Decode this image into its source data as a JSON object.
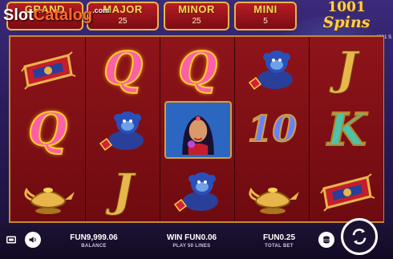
{
  "jackpots": [
    {
      "label": "GRAND",
      "value": ""
    },
    {
      "label": "MAJOR",
      "value": "25"
    },
    {
      "label": "MINOR",
      "value": "25"
    },
    {
      "label": "MINI",
      "value": "5"
    }
  ],
  "logo": {
    "number": "1001",
    "word": "Spins"
  },
  "version": "1001 S",
  "watermark": {
    "part1": "Slot",
    "part2": "Catalog",
    "suffix": ".com"
  },
  "reels": [
    [
      "magic-carpet",
      "Q",
      "lamp"
    ],
    [
      "Q",
      "monkey",
      "J"
    ],
    [
      "Q",
      "princess",
      "monkey"
    ],
    [
      "monkey",
      "10",
      "lamp"
    ],
    [
      "J",
      "K",
      "magic-carpet"
    ]
  ],
  "footer": {
    "balance_value": "FUN9,999.06",
    "balance_label": "BALANCE",
    "win_value": "WIN FUN0.06",
    "win_label": "PLAY 50 LINES",
    "bet_value": "FUN0.25",
    "bet_label": "TOTAL BET"
  },
  "icons": {
    "screen": "fullscreen-icon",
    "sound": "speaker-icon",
    "coins": "coin-stack-icon",
    "spin": "spin-arrows-icon"
  },
  "colors": {
    "reel_bg": "#8e141a",
    "frame_gold": "#c58a2c",
    "jackpot_red": "#b81c24"
  }
}
